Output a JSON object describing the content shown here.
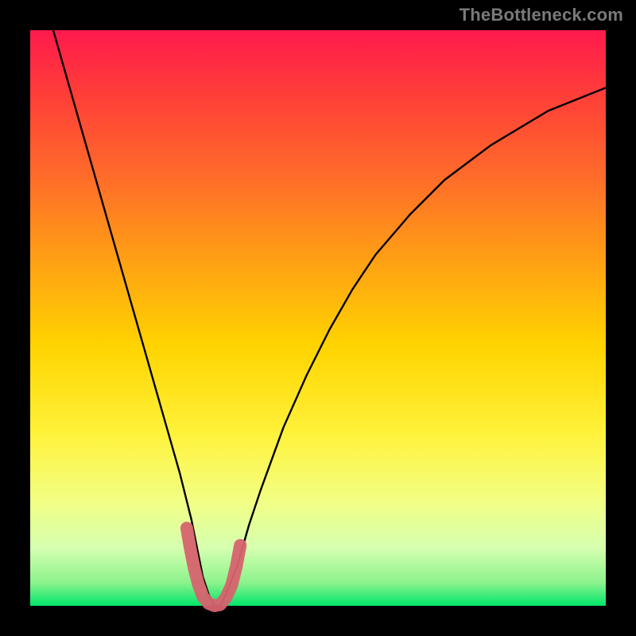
{
  "watermark": "TheBottleneck.com",
  "chart_data": {
    "type": "line",
    "title": "",
    "xlabel": "",
    "ylabel": "",
    "xlim": [
      0,
      100
    ],
    "ylim": [
      0,
      100
    ],
    "series": [
      {
        "name": "bottleneck-curve",
        "color": "#000000",
        "x": [
          4,
          6,
          8,
          10,
          12,
          14,
          16,
          18,
          20,
          22,
          24,
          26,
          28,
          29,
          30,
          31,
          32,
          33,
          34,
          36,
          38,
          40,
          44,
          48,
          52,
          56,
          60,
          66,
          72,
          80,
          90,
          100
        ],
        "y": [
          100,
          93,
          86,
          79,
          72,
          65,
          58,
          51,
          44,
          37,
          30,
          23,
          15,
          10,
          5,
          2,
          0,
          0,
          2,
          7,
          14,
          20,
          31,
          40,
          48,
          55,
          61,
          68,
          74,
          80,
          86,
          90
        ]
      },
      {
        "name": "highlight-segment",
        "color": "#d6636e",
        "x": [
          27.2,
          27.8,
          28.5,
          29.2,
          30.0,
          31.0,
          32.0,
          33.0,
          34.0,
          35.0,
          35.8,
          36.5
        ],
        "y": [
          13.5,
          10.0,
          6.5,
          3.8,
          1.6,
          0.4,
          0.0,
          0.2,
          1.4,
          3.6,
          6.8,
          10.5
        ]
      }
    ]
  }
}
